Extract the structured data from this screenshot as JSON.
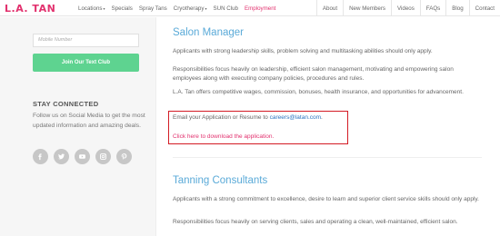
{
  "header": {
    "logo": "L.A. TAN",
    "nav_left": [
      {
        "label": "Locations",
        "caret": true,
        "active": false
      },
      {
        "label": "Specials",
        "caret": false,
        "active": false
      },
      {
        "label": "Spray Tans",
        "caret": false,
        "active": false
      },
      {
        "label": "Cryotherapy",
        "caret": true,
        "active": false
      },
      {
        "label": "SUN Club",
        "caret": false,
        "active": false
      },
      {
        "label": "Employment",
        "caret": false,
        "active": true
      }
    ],
    "nav_right": [
      "About",
      "New Members",
      "Videos",
      "FAQs",
      "Blog",
      "Contact"
    ]
  },
  "sidebar": {
    "search_placeholder": "Mobile Number",
    "join_button": "Join Our Text Club",
    "stay_heading": "STAY CONNECTED",
    "stay_text": "Follow us on Social Media to get the most updated information and amazing deals.",
    "socials": [
      "facebook-icon",
      "twitter-icon",
      "youtube-icon",
      "instagram-icon",
      "pinterest-icon"
    ]
  },
  "main": {
    "salon_title": "Salon Manager",
    "salon_p1": "Applicants with strong leadership skills, problem solving and multitasking abilities should only apply.",
    "salon_p2": "Responsibilities focus heavily on leadership, efficient salon management, motivating and empowering salon employees along with executing company policies, procedures and rules.",
    "salon_p3": "L.A. Tan offers competitive wages, commission, bonuses, health insurance, and opportunities for advancement.",
    "email_prefix": "Email your Application or Resume to ",
    "email_link": "careers@latan.com",
    "email_suffix": ".",
    "download_link": "Click here to download the application.",
    "tanning_title": "Tanning Consultants",
    "tanning_p1": "Applicants with a strong commitment to excellence, desire to learn and superior client service skills should only apply.",
    "tanning_p2": "Responsibilities focus heavily on serving clients, sales and operating a clean, well-maintained, efficient salon."
  },
  "colors": {
    "brand_pink": "#e2316e",
    "title_blue": "#5aaad8",
    "join_green": "#5ed390",
    "highlight_red": "#d31b24"
  }
}
